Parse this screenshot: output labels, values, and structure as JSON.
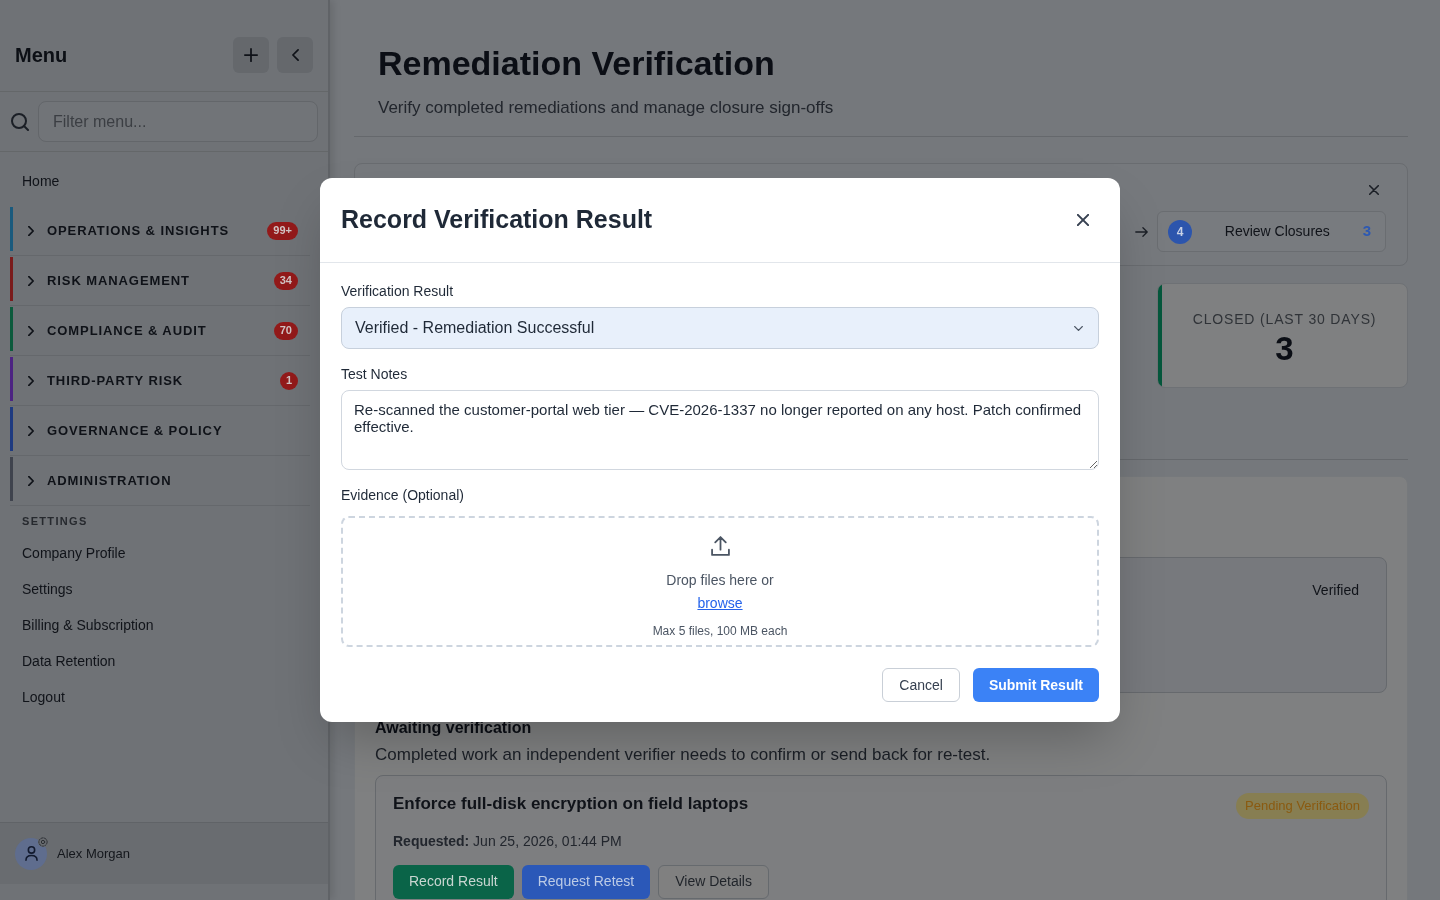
{
  "sidebar": {
    "title": "Menu",
    "filter": {
      "placeholder": "Filter menu..."
    },
    "home": "Home",
    "groups": [
      {
        "label": "OPERATIONS & INSIGHTS",
        "color": "#1a5a7d",
        "badge": "99+",
        "expanded": false
      },
      {
        "label": "RISK MANAGEMENT",
        "color": "#7a1b1b",
        "badge": "34",
        "expanded": false
      },
      {
        "label": "COMPLIANCE & AUDIT",
        "color": "#0c5a3c",
        "badge": "70",
        "expanded": false
      },
      {
        "label": "THIRD-PARTY RISK",
        "color": "#4c2382",
        "badge": "1",
        "expanded": false
      },
      {
        "label": "GOVERNANCE & POLICY",
        "color": "#1e3a80",
        "expanded": false
      },
      {
        "label": "ADMINISTRATION",
        "color": "#3f434d",
        "expanded": false
      }
    ],
    "settings": {
      "heading": "SETTINGS",
      "items": [
        "Company Profile",
        "Settings",
        "Billing & Subscription",
        "Data Retention",
        "Logout"
      ]
    },
    "user": {
      "name": "Alex Morgan"
    }
  },
  "page": {
    "title": "Remediation Verification",
    "subtitle": "Verify completed remediations and manage closure sign-offs"
  },
  "workflow": {
    "steps": [
      {
        "number": "4",
        "label": "Review Closures",
        "count": "3"
      }
    ]
  },
  "stats": [
    {
      "label": "CLOSED (LAST 30 DAYS)",
      "value": "3",
      "color": "#05573c"
    }
  ],
  "completed_items": [
    {
      "status": "Verified"
    }
  ],
  "awaiting": {
    "heading": "Awaiting verification",
    "description": "Completed work an independent verifier needs to confirm or send back for re-test.",
    "items": [
      {
        "title": "Enforce full-disk encryption on field laptops",
        "status": "Pending Verification",
        "requested": "**Requested:** Jun 25, 2026, 01:44 PM",
        "actions": [
          {
            "label": "Record Result",
            "kind": "success"
          },
          {
            "label": "Request Retest",
            "kind": "primary"
          },
          {
            "label": "View Details",
            "kind": "secondary"
          }
        ]
      }
    ]
  },
  "modal": {
    "title": "Record Verification Result",
    "fields": [
      {
        "kind": "select",
        "label": "Verification Result",
        "value": "Verified - Remediation Successful"
      },
      {
        "kind": "textarea",
        "label": "Test Notes",
        "value": "Re-scanned the customer-portal web tier — CVE-2026-1337 no longer reported on any host. Patch confirmed effective."
      },
      {
        "kind": "dropzone",
        "label": "Evidence (Optional)",
        "prompt": "Drop files here or",
        "link": "browse",
        "hint": "Max 5 files, 100 MB each"
      }
    ],
    "buttons": [
      {
        "label": "Cancel",
        "kind": "secondary"
      },
      {
        "label": "Submit Result",
        "kind": "primary"
      }
    ]
  }
}
